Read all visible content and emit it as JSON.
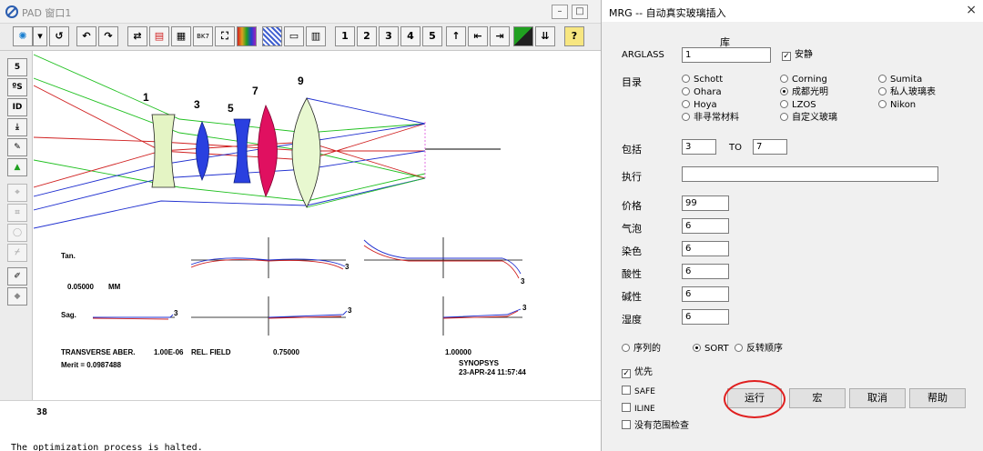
{
  "pad": {
    "title": "PAD 窗口1",
    "toolbar": {
      "cycle_icons": [
        "sun-gear-icon",
        "dropdown-icon",
        "refresh-icon",
        "rotate-left-icon",
        "rotate-right-icon",
        "swap-icon",
        "layout-icon",
        "grid-icon"
      ],
      "bk7_label": "BK7",
      "page_buttons": [
        "1",
        "2",
        "3",
        "4",
        "5"
      ],
      "help_label": "?"
    },
    "left_tools": [
      "5",
      "ºS",
      "ID"
    ],
    "lens_labels": [
      "1",
      "3",
      "5",
      "7",
      "9"
    ],
    "aberration": {
      "tan_label": "Tan.",
      "scale_value": "0.05000",
      "scale_unit": "MM",
      "sag_label": "Sag.",
      "surface_marker": "3",
      "caption": "TRANSVERSE ABER.",
      "field_start": "1.00E-06",
      "field_label": "REL. FIELD",
      "field_mid": "0.75000",
      "field_end": "1.00000",
      "merit": "Merit = 0.0987488",
      "program": "SYNOPSYS",
      "timestamp": "23-APR-24  11:57:44"
    },
    "console": {
      "line_number": "38",
      "message": "The optimization process is halted."
    }
  },
  "dialog": {
    "title": "MRG -- 自动真实玻璃插入",
    "close": "×",
    "library_header": "库",
    "arglass_label": "ARGLASS",
    "arglass_value": "1",
    "quiet_label": "安静",
    "quiet_checked": true,
    "catalog_label": "目录",
    "catalogs": [
      {
        "label": "Schott",
        "selected": false
      },
      {
        "label": "Ohara",
        "selected": false
      },
      {
        "label": "Hoya",
        "selected": false
      },
      {
        "label": "非寻常材料",
        "selected": false
      },
      {
        "label": "Corning",
        "selected": false
      },
      {
        "label": "成都光明",
        "selected": true
      },
      {
        "label": "LZOS",
        "selected": false
      },
      {
        "label": "自定义玻璃",
        "selected": false
      },
      {
        "label": "Sumita",
        "selected": false
      },
      {
        "label": "私人玻璃表",
        "selected": false
      },
      {
        "label": "Nikon",
        "selected": false
      }
    ],
    "include_label": "包括",
    "include_from": "3",
    "to_label": "TO",
    "include_to": "7",
    "execute_label": "执行",
    "execute_value": "",
    "price_label": "价格",
    "price_value": "99",
    "bubble_label": "气泡",
    "bubble_value": "6",
    "stain_label": "染色",
    "stain_value": "6",
    "acid_label": "酸性",
    "acid_value": "6",
    "alkali_label": "碱性",
    "alkali_value": "6",
    "humidity_label": "湿度",
    "humidity_value": "6",
    "order_options": [
      {
        "label": "序列的",
        "selected": false
      },
      {
        "label": "SORT",
        "selected": true
      },
      {
        "label": "反转顺序",
        "selected": false
      }
    ],
    "checks": [
      {
        "label": "优先",
        "checked": true
      },
      {
        "label": "SAFE",
        "checked": false
      },
      {
        "label": "ILINE",
        "checked": false
      },
      {
        "label": "没有范围检查",
        "checked": false
      }
    ],
    "buttons": {
      "run": "运行",
      "macro": "宏",
      "cancel": "取消",
      "help": "帮助"
    }
  }
}
